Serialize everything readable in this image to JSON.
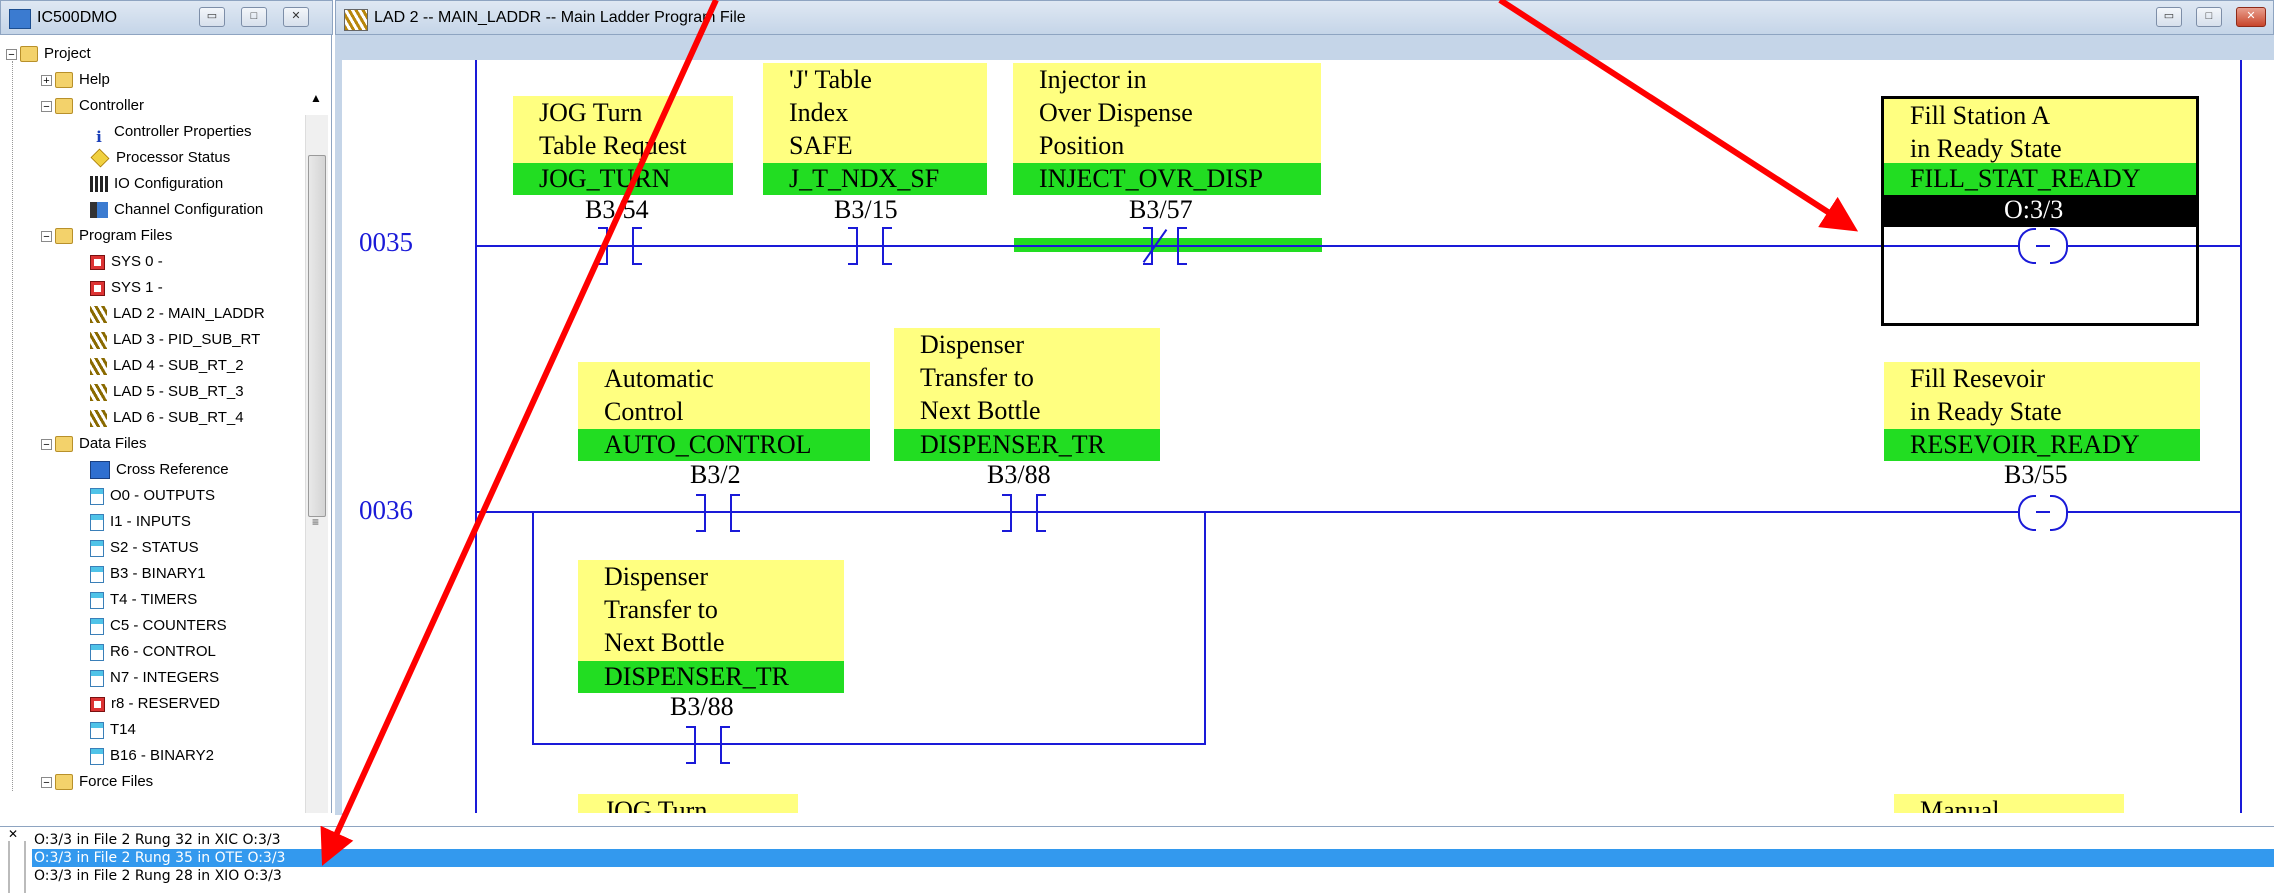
{
  "project_window": {
    "title": "IC500DMO"
  },
  "project_tree": [
    {
      "label": "Project",
      "icon": "folder-icon",
      "expander": "−",
      "level": 0
    },
    {
      "label": "Help",
      "icon": "folder-icon",
      "expander": "+",
      "level": 1
    },
    {
      "label": "Controller",
      "icon": "folder-icon",
      "expander": "−",
      "level": 1
    },
    {
      "label": "Controller Properties",
      "icon": "info-icon",
      "level": 2
    },
    {
      "label": "Processor Status",
      "icon": "processor-icon",
      "level": 2
    },
    {
      "label": "IO Configuration",
      "icon": "io-config-icon",
      "level": 2
    },
    {
      "label": "Channel Configuration",
      "icon": "channel-icon",
      "level": 2
    },
    {
      "label": "Program Files",
      "icon": "folder-icon",
      "expander": "−",
      "level": 1
    },
    {
      "label": "SYS 0 -",
      "icon": "system-file-icon",
      "level": 2
    },
    {
      "label": "SYS 1 -",
      "icon": "system-file-icon",
      "level": 2
    },
    {
      "label": "LAD 2 - MAIN_LADDR",
      "icon": "ladder-file-icon",
      "level": 2
    },
    {
      "label": "LAD 3 - PID_SUB_RT",
      "icon": "ladder-file-icon",
      "level": 2
    },
    {
      "label": "LAD 4 - SUB_RT_2",
      "icon": "ladder-file-icon",
      "level": 2
    },
    {
      "label": "LAD 5 - SUB_RT_3",
      "icon": "ladder-file-icon",
      "level": 2
    },
    {
      "label": "LAD 6 - SUB_RT_4",
      "icon": "ladder-file-icon",
      "level": 2
    },
    {
      "label": "Data Files",
      "icon": "folder-icon",
      "expander": "−",
      "level": 1
    },
    {
      "label": "Cross Reference",
      "icon": "cross-reference-icon",
      "level": 2
    },
    {
      "label": "O0 - OUTPUTS",
      "icon": "data-file-icon",
      "level": 2
    },
    {
      "label": "I1 - INPUTS",
      "icon": "data-file-icon",
      "level": 2
    },
    {
      "label": "S2 - STATUS",
      "icon": "data-file-icon",
      "level": 2
    },
    {
      "label": "B3 - BINARY1",
      "icon": "data-file-icon",
      "level": 2
    },
    {
      "label": "T4 - TIMERS",
      "icon": "data-file-icon",
      "level": 2
    },
    {
      "label": "C5 - COUNTERS",
      "icon": "data-file-icon",
      "level": 2
    },
    {
      "label": "R6 - CONTROL",
      "icon": "data-file-icon",
      "level": 2
    },
    {
      "label": "N7 - INTEGERS",
      "icon": "data-file-icon",
      "level": 2
    },
    {
      "label": "r8 - RESERVED",
      "icon": "system-file-icon",
      "level": 2
    },
    {
      "label": "T14",
      "icon": "data-file-icon",
      "level": 2
    },
    {
      "label": "B16 - BINARY2",
      "icon": "data-file-icon",
      "level": 2
    },
    {
      "label": "Force Files",
      "icon": "folder-icon",
      "expander": "−",
      "level": 1
    }
  ],
  "ladder_window": {
    "title": "LAD 2 -- MAIN_LADDR -- Main Ladder Program File"
  },
  "rungs": [
    {
      "number": "0035"
    },
    {
      "number": "0036"
    }
  ],
  "instructions": [
    {
      "id": "jog-turn",
      "description": [
        "JOG Turn",
        "Table Request"
      ],
      "symbol": "JOG_TURN",
      "address": "B3/54",
      "type": "XIC"
    },
    {
      "id": "jt-index",
      "description": [
        "'J' Table",
        "Index",
        "SAFE"
      ],
      "symbol": "J_T_NDX_SF",
      "address": "B3/15",
      "type": "XIC"
    },
    {
      "id": "injector",
      "description": [
        "Injector in",
        "Over Dispense",
        "Position"
      ],
      "symbol": "INJECT_OVR_DISP",
      "address": "B3/57",
      "type": "XIO"
    },
    {
      "id": "fill-station",
      "description": [
        "Fill Station A",
        "in Ready State"
      ],
      "symbol": "FILL_STAT_READY",
      "address": "O:3/3",
      "type": "OTE"
    },
    {
      "id": "auto-control",
      "description": [
        "Automatic",
        "Control"
      ],
      "symbol": "AUTO_CONTROL",
      "address": "B3/2",
      "type": "XIC"
    },
    {
      "id": "dispenser-1",
      "description": [
        "Dispenser",
        "Transfer to",
        "Next Bottle"
      ],
      "symbol": "DISPENSER_TR",
      "address": "B3/88",
      "type": "XIC"
    },
    {
      "id": "fill-reservoir",
      "description": [
        "Fill Resevoir",
        "in Ready State"
      ],
      "symbol": "RESEVOIR_READY",
      "address": "B3/55",
      "type": "OTE"
    },
    {
      "id": "dispenser-2",
      "description": [
        "Dispenser",
        "Transfer to",
        "Next Bottle"
      ],
      "symbol": "DISPENSER_TR",
      "address": "B3/88",
      "type": "XIC"
    }
  ],
  "partial_next_rung": {
    "left_text": "JOG Turn",
    "right_text": "Manual"
  },
  "output_results": [
    {
      "text": "O:3/3 in File 2 Rung 32 in XIC O:3/3",
      "selected": false
    },
    {
      "text": "O:3/3 in File 2 Rung 35 in OTE O:3/3",
      "selected": true
    },
    {
      "text": "O:3/3 in File 2 Rung 28 in XIO O:3/3",
      "selected": false
    }
  ],
  "colors": {
    "description_bg": "#ffff80",
    "symbol_bg": "#22dd22",
    "rail": "#1a1ad8",
    "highlight": "#000000",
    "selection": "#3399ee",
    "annotation_arrow": "#ff0000"
  }
}
